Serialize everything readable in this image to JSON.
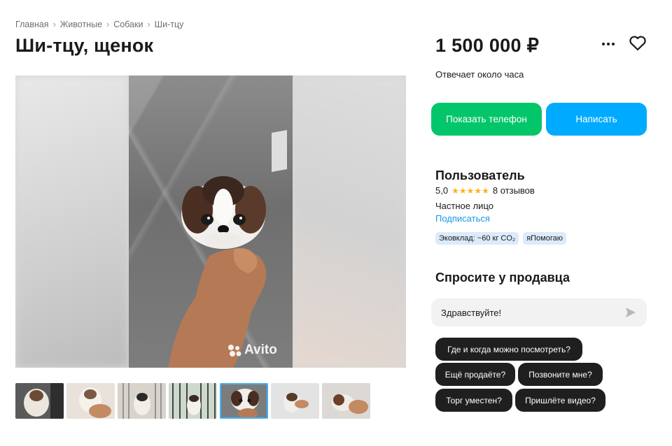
{
  "breadcrumbs": [
    {
      "label": "Главная"
    },
    {
      "label": "Животные"
    },
    {
      "label": "Собаки"
    },
    {
      "label": "Ши-тцу"
    }
  ],
  "breadcrumb_separator": "›",
  "title": "Ши-тцу, щенок",
  "gallery": {
    "watermark": "Avito",
    "thumbnails_count": 7,
    "active_thumbnail": 5
  },
  "price": "1 500 000 ₽",
  "response_time": "Отвечает около часа",
  "buttons": {
    "show_phone": "Показать телефон",
    "write": "Написать"
  },
  "seller": {
    "name": "Пользователь",
    "rating": "5,0",
    "stars": "★★★★★",
    "reviews": "8 отзывов",
    "type": "Частное лицо",
    "subscribe": "Подписаться",
    "badges": [
      "Эковклад: ~60 кг CO₂",
      "яПомогаю"
    ]
  },
  "ask": {
    "title": "Спросите у продавца",
    "message_value": "Здравствуйте!",
    "quick_questions": [
      "Где и когда можно посмотреть?",
      "Ещё продаёте?",
      "Позвоните мне?",
      "Торг уместен?",
      "Пришлёте видео?"
    ]
  },
  "colors": {
    "phone_button": "#03c66a",
    "write_button": "#00aaff",
    "link": "#1399e8",
    "stars": "#ffb021",
    "badge_bg": "#dcebfb",
    "chip_bg": "#1f1f1f"
  },
  "icons": [
    "more-dots-icon",
    "heart-icon",
    "send-icon",
    "avito-logo-icon",
    "star-icon"
  ]
}
